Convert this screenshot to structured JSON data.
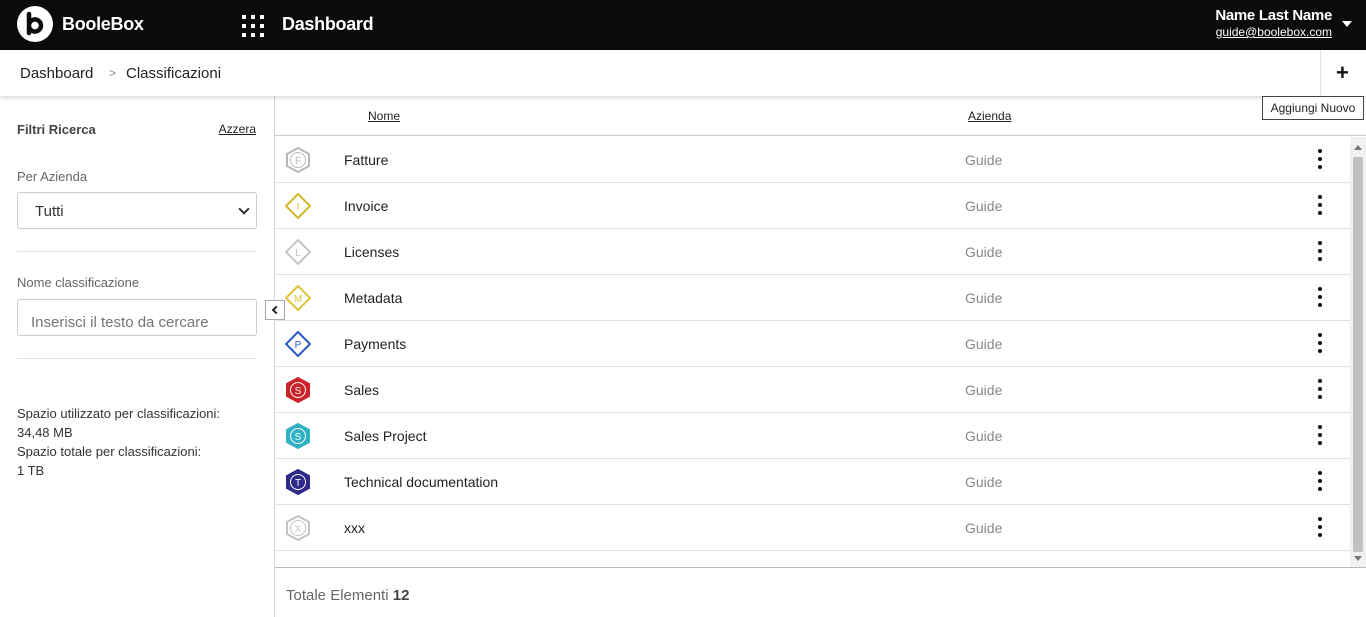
{
  "topbar": {
    "brand": "BooleBox",
    "app_title": "Dashboard",
    "user_name": "Name Last Name",
    "user_email": "guide@boolebox.com"
  },
  "breadcrumb": {
    "items": [
      "Dashboard",
      "Classificazioni"
    ],
    "separator": ">"
  },
  "add_button": {
    "label": "+",
    "tooltip": "Aggiungi Nuovo"
  },
  "sidebar": {
    "title": "Filtri Ricerca",
    "reset_label": "Azzera",
    "company_label": "Per Azienda",
    "company_value": "Tutti",
    "name_label": "Nome classificazione",
    "name_placeholder": "Inserisci il testo da cercare",
    "space_used_label": "Spazio utilizzato per classificazioni:",
    "space_used_value": "34,48 MB",
    "space_total_label": "Spazio totale per classificazioni:",
    "space_total_value": "1 TB"
  },
  "table": {
    "columns": [
      "Nome",
      "Azienda"
    ],
    "rows": [
      {
        "name": "Fatture",
        "company": "Guide",
        "letter": "F",
        "shape": "hexagon",
        "color": "#b8b8b8",
        "filled": false
      },
      {
        "name": "Invoice",
        "company": "Guide",
        "letter": "I",
        "shape": "diamond",
        "color": "#d4b62a",
        "filled": false
      },
      {
        "name": "Licenses",
        "company": "Guide",
        "letter": "L",
        "shape": "diamond",
        "color": "#c4c4c4",
        "filled": false
      },
      {
        "name": "Metadata",
        "company": "Guide",
        "letter": "M",
        "shape": "diamond",
        "color": "#e0c23a",
        "filled": false
      },
      {
        "name": "Payments",
        "company": "Guide",
        "letter": "P",
        "shape": "diamond",
        "color": "#2a58c8",
        "filled": false
      },
      {
        "name": "Sales",
        "company": "Guide",
        "letter": "S",
        "shape": "hexagon",
        "color": "#cc2229",
        "filled": true
      },
      {
        "name": "Sales Project",
        "company": "Guide",
        "letter": "S",
        "shape": "hexagon",
        "color": "#31b2c4",
        "filled": true
      },
      {
        "name": "Technical documentation",
        "company": "Guide",
        "letter": "T",
        "shape": "hexagon",
        "color": "#2e2a8a",
        "filled": true
      },
      {
        "name": "xxx",
        "company": "Guide",
        "letter": "X",
        "shape": "hexagon",
        "color": "#c4c4c4",
        "filled": false
      }
    ]
  },
  "footer": {
    "total_label": "Totale Elementi",
    "total_count": "12"
  },
  "colors": {
    "topbar_bg": "#0b0b0b",
    "accent": "#222222"
  }
}
